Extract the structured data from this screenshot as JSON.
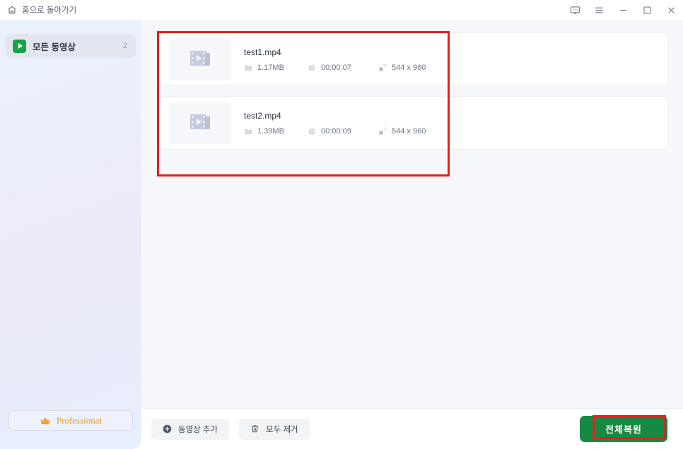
{
  "titlebar": {
    "home_label": "홈으로 돌아가기",
    "home_icon": "home-icon",
    "controls": [
      {
        "name": "feedback",
        "icon": "feedback-icon",
        "glyph": ""
      },
      {
        "name": "menu",
        "icon": "hamburger-menu-icon",
        "glyph": ""
      },
      {
        "name": "minimize",
        "icon": "minimize-icon",
        "glyph": ""
      },
      {
        "name": "maximize",
        "icon": "maximize-icon",
        "glyph": ""
      },
      {
        "name": "close",
        "icon": "close-icon",
        "glyph": ""
      }
    ]
  },
  "sidebar": {
    "item": {
      "label": "모든 동영상",
      "count": "2",
      "icon": "video-play-icon"
    },
    "pro_button": {
      "label": "Professional",
      "icon": "crown-icon"
    }
  },
  "files": [
    {
      "name": "test1.mp4",
      "size": "1.17MB",
      "duration": "00:00:07",
      "resolution": "544 x 960",
      "thumb_icon": "film-play-icon",
      "size_icon": "file-icon",
      "duration_icon": "clock-icon",
      "resolution_icon": "resize-icon"
    },
    {
      "name": "test2.mp4",
      "size": "1.39MB",
      "duration": "00:00:09",
      "resolution": "544 x 960",
      "thumb_icon": "film-play-icon",
      "size_icon": "file-icon",
      "duration_icon": "clock-icon",
      "resolution_icon": "resize-icon"
    }
  ],
  "bottombar": {
    "add_video_label": "동영상 추가",
    "add_video_icon": "plus-circle-icon",
    "remove_all_label": "모두 제거",
    "remove_all_icon": "trash-icon",
    "restore_all_label": "전체복원"
  },
  "colors": {
    "accent_green": "#148a42",
    "badge_green": "#17a34a",
    "annotation_red": "#e02020",
    "pro_orange": "#e8951f",
    "content_bg": "#f6f8fb"
  }
}
